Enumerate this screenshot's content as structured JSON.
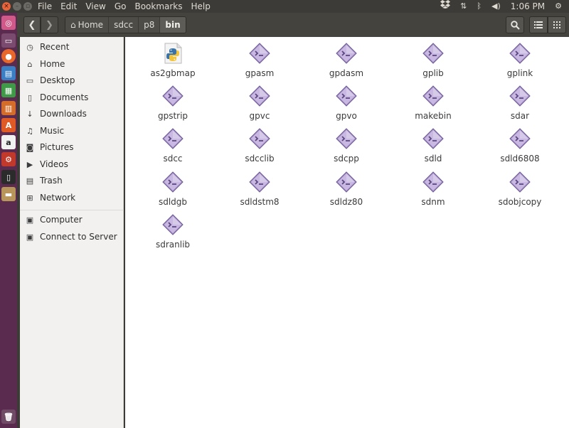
{
  "menu_bar": {
    "items": [
      "File",
      "Edit",
      "View",
      "Go",
      "Bookmarks",
      "Help"
    ],
    "clock": "1:06 PM"
  },
  "header": {
    "breadcrumbs": [
      "Home",
      "sdcc",
      "p8",
      "bin"
    ]
  },
  "sidebar": {
    "items": [
      {
        "label": "Recent",
        "icon": "clock-icon"
      },
      {
        "label": "Home",
        "icon": "home-icon"
      },
      {
        "label": "Desktop",
        "icon": "desktop-icon"
      },
      {
        "label": "Documents",
        "icon": "document-icon"
      },
      {
        "label": "Downloads",
        "icon": "download-icon"
      },
      {
        "label": "Music",
        "icon": "music-icon"
      },
      {
        "label": "Pictures",
        "icon": "camera-icon"
      },
      {
        "label": "Videos",
        "icon": "video-icon"
      },
      {
        "label": "Trash",
        "icon": "trash-icon"
      },
      {
        "label": "Network",
        "icon": "network-icon"
      },
      {
        "label": "Computer",
        "icon": "computer-icon"
      },
      {
        "label": "Connect to Server",
        "icon": "server-icon"
      }
    ]
  },
  "files": [
    {
      "name": "as2gbmap",
      "type": "python"
    },
    {
      "name": "gpasm",
      "type": "executable"
    },
    {
      "name": "gpdasm",
      "type": "executable"
    },
    {
      "name": "gplib",
      "type": "executable"
    },
    {
      "name": "gplink",
      "type": "executable"
    },
    {
      "name": "gpstrip",
      "type": "executable"
    },
    {
      "name": "gpvc",
      "type": "executable"
    },
    {
      "name": "gpvo",
      "type": "executable"
    },
    {
      "name": "makebin",
      "type": "executable"
    },
    {
      "name": "sdar",
      "type": "executable"
    },
    {
      "name": "sdcc",
      "type": "executable"
    },
    {
      "name": "sdcclib",
      "type": "executable"
    },
    {
      "name": "sdcpp",
      "type": "executable"
    },
    {
      "name": "sdld",
      "type": "executable"
    },
    {
      "name": "sdld6808",
      "type": "executable"
    },
    {
      "name": "sdldgb",
      "type": "executable"
    },
    {
      "name": "sdldstm8",
      "type": "executable"
    },
    {
      "name": "sdldz80",
      "type": "executable"
    },
    {
      "name": "sdnm",
      "type": "executable"
    },
    {
      "name": "sdobjcopy",
      "type": "executable"
    },
    {
      "name": "sdranlib",
      "type": "executable"
    }
  ],
  "colors": {
    "launcher": "#5a2a4f",
    "panel": "#3c3b37",
    "header": "#44433e",
    "sidebar": "#f2f1f0",
    "exec_icon": "#8a6fb0"
  }
}
